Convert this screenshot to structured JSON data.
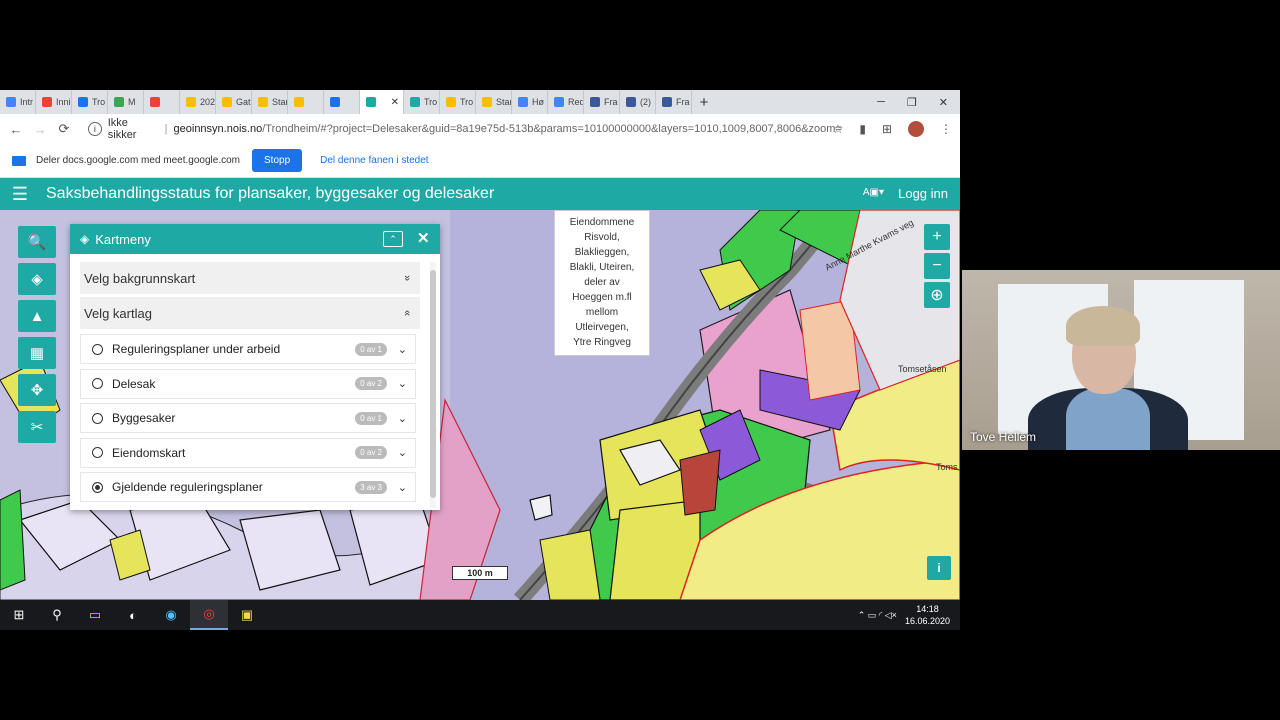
{
  "browser": {
    "tabs": [
      {
        "label": "Intr",
        "color": "#4285f4"
      },
      {
        "label": "Inni",
        "color": "#ea4335"
      },
      {
        "label": "Tro",
        "color": "#1a73e8"
      },
      {
        "label": "M",
        "color": "#34a853"
      },
      {
        "label": "",
        "color": "#ea4335"
      },
      {
        "label": "202",
        "color": "#fbbc04"
      },
      {
        "label": "Gat",
        "color": "#fbbc04"
      },
      {
        "label": "Star",
        "color": "#fbbc04"
      },
      {
        "label": "",
        "color": "#fbbc04"
      },
      {
        "label": "",
        "color": "#1a73e8"
      },
      {
        "label": "",
        "color": "#1fa9a5",
        "active": true
      },
      {
        "label": "Tro",
        "color": "#1fa9a5"
      },
      {
        "label": "Tro",
        "color": "#fbbc04"
      },
      {
        "label": "Star",
        "color": "#fbbc04"
      },
      {
        "label": "Hø",
        "color": "#4285f4"
      },
      {
        "label": "Red",
        "color": "#4285f4"
      },
      {
        "label": "Fra",
        "color": "#3b5998"
      },
      {
        "label": "(2)",
        "color": "#3b5998"
      },
      {
        "label": "Fra",
        "color": "#3b5998"
      }
    ],
    "new_tab": "+",
    "window_controls": {
      "minimize": "─",
      "restore": "❐",
      "close": "✕"
    },
    "nav": {
      "back": "←",
      "forward": "→",
      "reload": "⟳"
    },
    "security_label": "Ikke sikker",
    "url_host": "geoinnsyn.nois.no",
    "url_path": "/Trondheim/#?project=Delesaker&guid=8a19e75d-513b&params=10100000000&layers=1010,1009,8007,8006&zoom= ...",
    "icons": {
      "star": "☆",
      "extension": "▮",
      "grid": "⊞",
      "menu": "⋮"
    }
  },
  "share_bar": {
    "message": "Deler docs.google.com med meet.google.com",
    "stop_label": "Stopp",
    "share_tab_label": "Del denne fanen i stedet"
  },
  "app": {
    "menu_icon": "☰",
    "title": "Saksbehandlingsstatus for plansaker, byggesaker og delesaker",
    "lang_label": "A▣▾",
    "login_label": "Logg inn"
  },
  "left_tools": [
    {
      "name": "search-tool",
      "icon": "🔍"
    },
    {
      "name": "layers-tool",
      "icon": "◈"
    },
    {
      "name": "tool-3",
      "icon": "▲"
    },
    {
      "name": "tool-4",
      "icon": "▦"
    },
    {
      "name": "tool-5",
      "icon": "✥"
    },
    {
      "name": "tool-6",
      "icon": "✂"
    }
  ],
  "panel": {
    "icon": "◈",
    "title": "Kartmeny",
    "collapse_icon": "⌃",
    "close_icon": "✕",
    "section_background": "Velg bakgrunnskart",
    "section_background_chev": "»",
    "section_layers": "Velg kartlag",
    "section_layers_chev": "«",
    "layers": [
      {
        "label": "Reguleringsplaner under arbeid",
        "count": "0 av 1",
        "checked": false
      },
      {
        "label": "Delesak",
        "count": "0 av 2",
        "checked": false
      },
      {
        "label": "Byggesaker",
        "count": "0 av 1",
        "checked": false
      },
      {
        "label": "Eiendomskart",
        "count": "0 av 2",
        "checked": false
      },
      {
        "label": "Gjeldende reguleringsplaner",
        "count": "3 av 3",
        "checked": true
      }
    ],
    "row_chev": "⌄"
  },
  "popup": {
    "lines": [
      "Eiendommene",
      "Risvold,",
      "Blaklieggen,",
      "Blakli, Uteiren,",
      "deler av",
      "Hoeggen m.fl",
      "mellom",
      "Utleirvegen,",
      "Ytre Ringveg"
    ]
  },
  "map_controls": {
    "zoom_in": "+",
    "zoom_out": "−",
    "locate": "⊕",
    "info": "i"
  },
  "map_labels": {
    "scale": "100 m",
    "street": "Anne Marthe Kvams veg",
    "place": "Tomsetåsen",
    "place2": "Toms"
  },
  "taskbar": {
    "start": "⊞",
    "search": "⚲",
    "apps": [
      "▭",
      "◐",
      "◉",
      "◎",
      "▣"
    ],
    "tray_icons": "⌃ ▭ ◜ ◁×",
    "time": "14:18",
    "date": "16.06.2020"
  },
  "webcam": {
    "name": "Tove Hellem"
  }
}
